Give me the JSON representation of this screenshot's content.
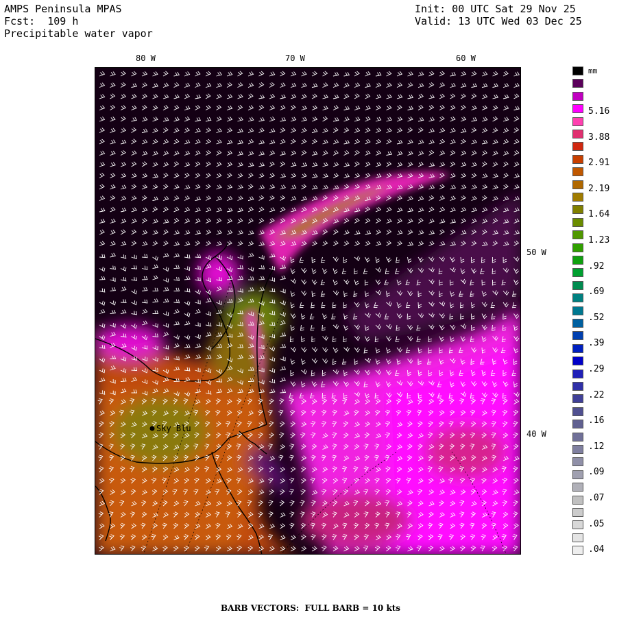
{
  "header": {
    "model": "AMPS Peninsula MPAS",
    "forecast": "Fcst:  109 h",
    "field": "Precipitable water vapor",
    "init": "Init: 00 UTC Sat 29 Nov 25",
    "valid": "Valid: 13 UTC Wed 03 Dec 25"
  },
  "longitude_labels_top": [
    "80 W",
    "70 W",
    "60 W"
  ],
  "longitude_labels_right": [
    "50 W",
    "40 W"
  ],
  "station": {
    "name": "Sky Blu"
  },
  "legend": {
    "unit": "mm",
    "tick_labels": [
      "5.16",
      "3.88",
      "2.91",
      "2.19",
      "1.64",
      "1.23",
      ".92",
      ".69",
      ".52",
      ".39",
      ".29",
      ".22",
      ".16",
      ".12",
      ".09",
      ".07",
      ".05",
      ".04"
    ],
    "colors": [
      "#000000",
      "#5a005a",
      "#c000c0",
      "#ff00ff",
      "#ff40b0",
      "#e03070",
      "#d02810",
      "#c84000",
      "#c05800",
      "#b06800",
      "#a07c00",
      "#808000",
      "#6a8c00",
      "#509800",
      "#30a000",
      "#10a010",
      "#00a030",
      "#008c50",
      "#008080",
      "#007890",
      "#0060a0",
      "#0040b0",
      "#0020c0",
      "#0000c8",
      "#2020b8",
      "#3030a8",
      "#404098",
      "#505090",
      "#606090",
      "#707098",
      "#8080a0",
      "#9090a8",
      "#a0a0b0",
      "#b0b0b8",
      "#c0c0c0",
      "#cccccc",
      "#d8d8d8",
      "#e4e4e4",
      "#eeeeee"
    ]
  },
  "footer": "BARB VECTORS:  FULL BARB = 10 kts"
}
